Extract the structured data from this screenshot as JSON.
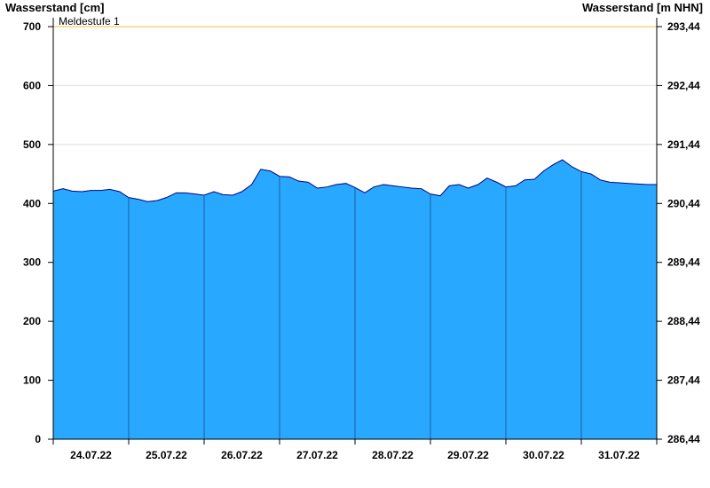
{
  "chart_data": {
    "type": "area",
    "y_left_title": "Wasserstand [cm]",
    "y_right_title": "Wasserstand [m NHN]",
    "ylim": [
      0,
      700
    ],
    "y_ticks_left": [
      "0",
      "100",
      "200",
      "300",
      "400",
      "500",
      "600",
      "700"
    ],
    "y_ticks_right": [
      "286,44",
      "287,44",
      "288,44",
      "289,44",
      "290,44",
      "291,44",
      "292,44",
      "293,44"
    ],
    "x_tick_labels": [
      "24.07.22",
      "25.07.22",
      "26.07.22",
      "27.07.22",
      "28.07.22",
      "29.07.22",
      "30.07.22",
      "31.07.22"
    ],
    "x_range_days": [
      0,
      8
    ],
    "threshold": {
      "label": "Meldestufe 1",
      "value": 700
    },
    "grid": true,
    "colors": {
      "area": "#29a8ff",
      "line": "#000080",
      "threshold": "#f0c040",
      "grid": "#dddddd",
      "day_divider": "#1a5fa0"
    },
    "series": [
      {
        "x": [
          0,
          0.13,
          0.25,
          0.38,
          0.5,
          0.63,
          0.75,
          0.88,
          1.0,
          1.13,
          1.25,
          1.38,
          1.5,
          1.63,
          1.75,
          1.88,
          2.0,
          2.13,
          2.25,
          2.38,
          2.5,
          2.63,
          2.75,
          2.88,
          3.0,
          3.13,
          3.25,
          3.38,
          3.5,
          3.63,
          3.75,
          3.88,
          4.0,
          4.13,
          4.25,
          4.38,
          4.5,
          4.63,
          4.75,
          4.88,
          5.0,
          5.13,
          5.25,
          5.38,
          5.5,
          5.63,
          5.75,
          5.88,
          6.0,
          6.13,
          6.25,
          6.38,
          6.5,
          6.63,
          6.75,
          6.88,
          7.0,
          7.13,
          7.25,
          7.38,
          7.5,
          7.63,
          7.75,
          7.88,
          8.0
        ],
        "values": [
          421,
          425,
          421,
          420,
          422,
          422,
          424,
          420,
          410,
          407,
          403,
          405,
          410,
          418,
          418,
          416,
          414,
          420,
          415,
          414,
          420,
          432,
          458,
          455,
          446,
          445,
          438,
          436,
          426,
          428,
          432,
          434,
          427,
          418,
          428,
          432,
          430,
          428,
          426,
          425,
          416,
          413,
          430,
          432,
          426,
          432,
          443,
          436,
          428,
          430,
          440,
          441,
          455,
          466,
          474,
          462,
          454,
          450,
          440,
          436,
          435,
          434,
          433,
          432,
          432
        ]
      }
    ]
  }
}
